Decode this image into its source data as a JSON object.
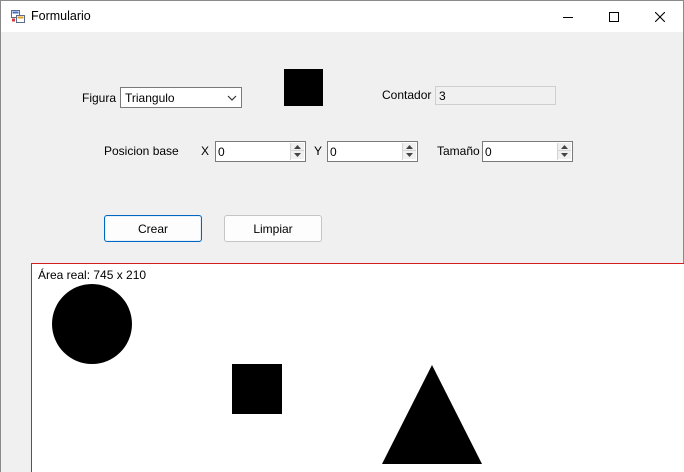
{
  "window": {
    "title": "Formulario",
    "minimize_icon": "minimize-icon",
    "maximize_icon": "maximize-icon",
    "close_icon": "close-icon"
  },
  "form": {
    "figura_label": "Figura",
    "figura_selected": "Triangulo",
    "contador_label": "Contador",
    "contador_value": "3",
    "posicion_label": "Posicion base",
    "x_label": "X",
    "x_value": "0",
    "y_label": "Y",
    "y_value": "0",
    "tamano_label": "Tamaño",
    "tamano_value": "0",
    "crear_label": "Crear",
    "limpiar_label": "Limpiar"
  },
  "canvas": {
    "area_label": "Área real: 745 x 210",
    "shapes": [
      "circle",
      "square",
      "triangle"
    ],
    "border_color": "#d21f1f",
    "shape_color": "#000000"
  },
  "colors": {
    "accent": "#0067c0",
    "window_bg": "#f0f0f0"
  }
}
